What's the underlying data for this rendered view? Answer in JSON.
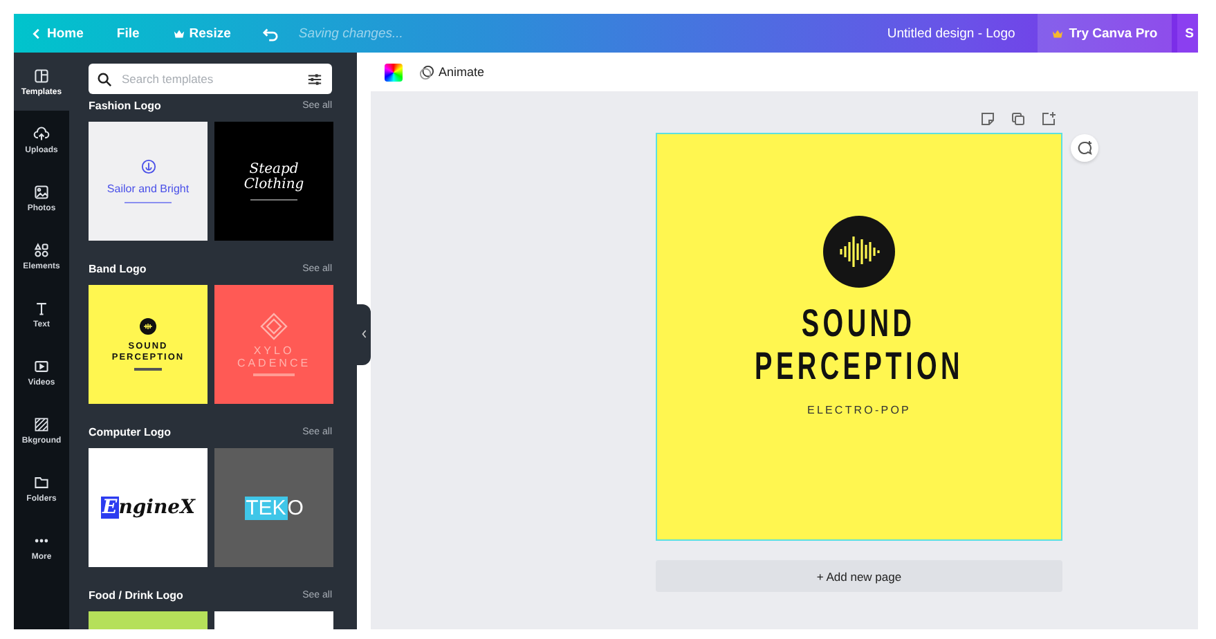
{
  "topbar": {
    "nav": [
      {
        "label": "Home"
      },
      {
        "label": "File"
      },
      {
        "label": "Resize"
      }
    ],
    "status": "Saving changes...",
    "title": "Untitled design - Logo",
    "pro_button": "Try Canva Pro",
    "share_button": "S"
  },
  "rail": [
    {
      "label": "Templates",
      "selected": true
    },
    {
      "label": "Uploads",
      "selected": false
    },
    {
      "label": "Photos",
      "selected": false
    },
    {
      "label": "Elements",
      "selected": false
    },
    {
      "label": "Text",
      "selected": false
    },
    {
      "label": "Videos",
      "selected": false
    },
    {
      "label": "Bkground",
      "selected": false
    },
    {
      "label": "Folders",
      "selected": false
    },
    {
      "label": "More",
      "selected": false
    }
  ],
  "search": {
    "placeholder": "Search templates"
  },
  "sections": [
    {
      "title": "Fashion Logo",
      "see_all": "See all",
      "templates": [
        {
          "kind": "sailor",
          "text": "Sailor and Bright"
        },
        {
          "kind": "script",
          "text": "Steapd Clothing"
        }
      ]
    },
    {
      "title": "Band Logo",
      "see_all": "See all",
      "templates": [
        {
          "kind": "band",
          "lines": [
            "SOUND",
            "PERCEPTION"
          ]
        },
        {
          "kind": "xylo",
          "lines": [
            "XYLO",
            "CADENCE"
          ]
        }
      ]
    },
    {
      "title": "Computer Logo",
      "see_all": "See all",
      "templates": [
        {
          "kind": "boxed-initial",
          "boxed": "E",
          "rest": "ngineX"
        },
        {
          "kind": "boxed-start",
          "boxed": "TEK",
          "rest": "O"
        }
      ]
    },
    {
      "title": "Food / Drink Logo",
      "see_all": "See all",
      "templates": [
        {
          "kind": "swatch",
          "color": "#b5e05a"
        },
        {
          "kind": "swatch",
          "color": "#ffffff"
        }
      ]
    }
  ],
  "canvas": {
    "animate": "Animate",
    "design": {
      "selected": true,
      "title_lines": [
        "SOUND",
        "PERCEPTION"
      ],
      "subtitle": "ELECTRO-POP"
    },
    "add_page": "+ Add new page"
  }
}
